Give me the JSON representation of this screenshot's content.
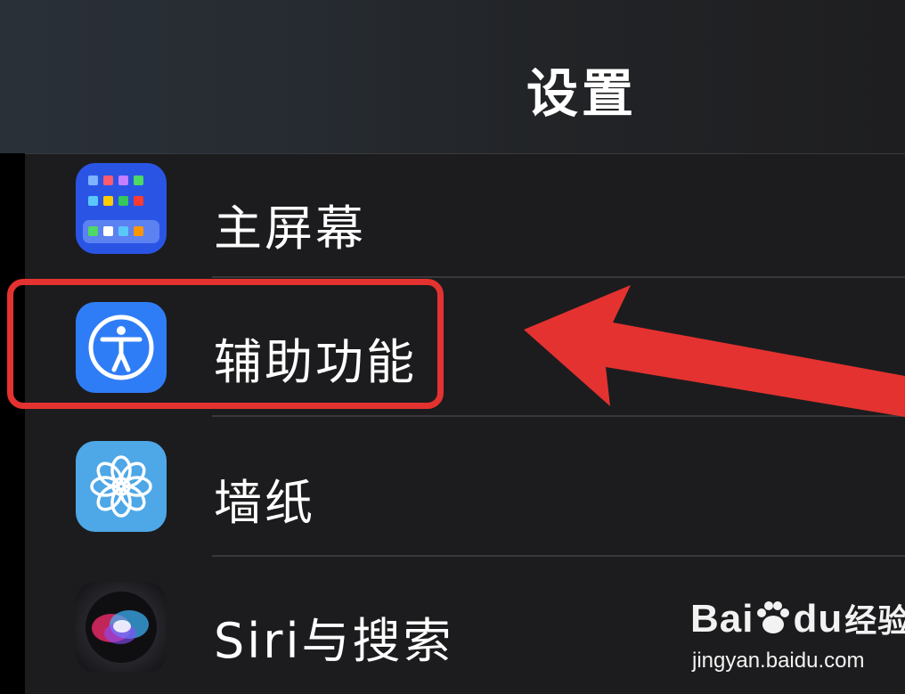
{
  "header": {
    "title": "设置"
  },
  "settings_rows": [
    {
      "label": "主屏幕",
      "icon": "home-screen-icon"
    },
    {
      "label": "辅助功能",
      "icon": "accessibility-icon",
      "highlighted": true
    },
    {
      "label": "墙纸",
      "icon": "wallpaper-icon"
    },
    {
      "label": "Siri与搜索",
      "icon": "siri-icon"
    }
  ],
  "annotation": {
    "highlight_color": "#e43230",
    "arrow_color": "#e43230"
  },
  "watermark": {
    "brand": "Bai",
    "brand_suffix": "du",
    "product": "经验",
    "url": "jingyan.baidu.com"
  },
  "colors": {
    "background": "#1c1c1e",
    "home_icon": "#2a55e4",
    "accessibility_icon": "#2f7df6",
    "wallpaper_icon": "#4ea7e6"
  }
}
